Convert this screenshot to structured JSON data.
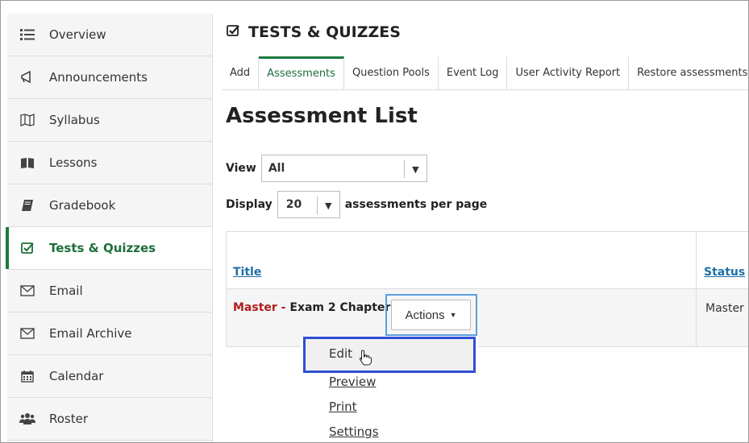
{
  "sidebar": {
    "items": [
      {
        "label": "Overview",
        "icon": "list-icon",
        "active": false
      },
      {
        "label": "Announcements",
        "icon": "megaphone-icon",
        "active": false
      },
      {
        "label": "Syllabus",
        "icon": "map-icon",
        "active": false
      },
      {
        "label": "Lessons",
        "icon": "book-open-icon",
        "active": false
      },
      {
        "label": "Gradebook",
        "icon": "book-icon",
        "active": false
      },
      {
        "label": "Tests & Quizzes",
        "icon": "check-square-icon",
        "active": true
      },
      {
        "label": "Email",
        "icon": "envelope-icon",
        "active": false
      },
      {
        "label": "Email Archive",
        "icon": "envelope-icon",
        "active": false
      },
      {
        "label": "Calendar",
        "icon": "calendar-icon",
        "active": false
      },
      {
        "label": "Roster",
        "icon": "users-icon",
        "active": false
      }
    ]
  },
  "tool": {
    "title": "TESTS & QUIZZES",
    "icon": "check-square-icon"
  },
  "tabs": [
    {
      "label": "Add",
      "active": false
    },
    {
      "label": "Assessments",
      "active": true
    },
    {
      "label": "Question Pools",
      "active": false
    },
    {
      "label": "Event Log",
      "active": false
    },
    {
      "label": "User Activity Report",
      "active": false
    },
    {
      "label": "Restore assessments",
      "active": false
    }
  ],
  "page": {
    "title": "Assessment List"
  },
  "filters": {
    "view_label": "View",
    "view_value": "All",
    "display_label": "Display",
    "display_value": "20",
    "display_suffix": "assessments per page"
  },
  "table": {
    "col_title": "Title",
    "col_status": "Status",
    "rows": [
      {
        "prefix": "Master - ",
        "name": "Exam 2 Chapters 3 & 4",
        "status": "Master"
      }
    ],
    "actions_label": "Actions"
  },
  "actions_menu": {
    "items": [
      "Edit",
      "Preview",
      "Print",
      "Settings"
    ]
  },
  "colors": {
    "accent_green": "#1b7a3d",
    "link_blue": "#1f6fa8",
    "master_red": "#b01e1e",
    "highlight_blue": "#2f4fd6"
  }
}
